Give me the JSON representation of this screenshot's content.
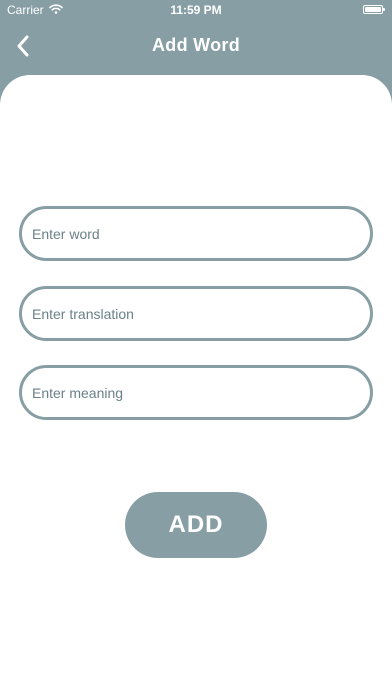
{
  "status_bar": {
    "carrier": "Carrier",
    "time": "11:59 PM",
    "icons": [
      "wifi-icon",
      "battery-icon"
    ]
  },
  "nav": {
    "title": "Add Word",
    "back_icon": "chevron-left-icon"
  },
  "form": {
    "word_placeholder": "Enter word",
    "word_value": "",
    "translation_placeholder": "Enter translation",
    "translation_value": "",
    "meaning_placeholder": "Enter meaning",
    "meaning_value": ""
  },
  "add_button_label": "ADD",
  "colors": {
    "accent": "#879ea5",
    "background": "#ffffff",
    "text_on_accent": "#ffffff"
  }
}
